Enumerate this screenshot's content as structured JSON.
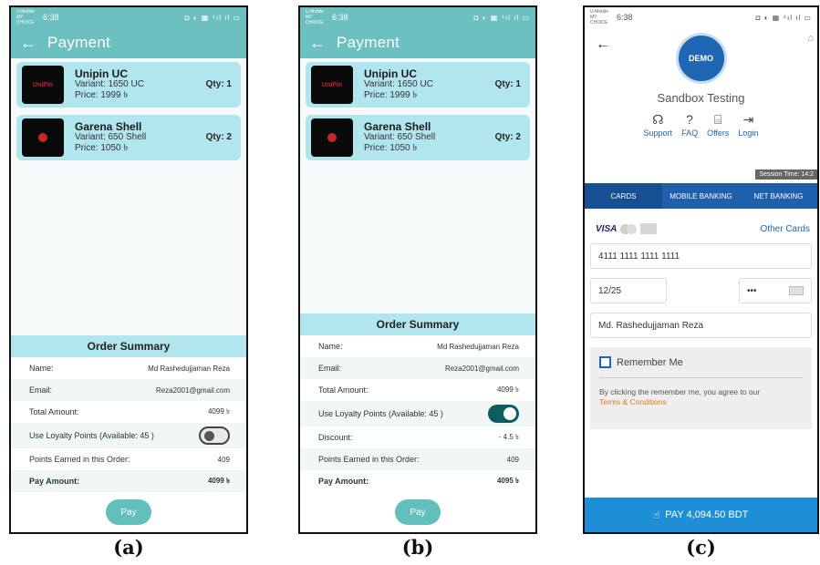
{
  "status": {
    "carrier": "U-Mobile MY CHOICE",
    "time": "6:38",
    "icons": "◘ ◐ ▦ ⁴ıl ıl ▭"
  },
  "payment_screen": {
    "back_icon": "←",
    "title": "Payment",
    "items": [
      {
        "name": "Unipin UC",
        "variant": "Variant: 1650 UC",
        "price": "Price: 1999 ৳",
        "qty": "Qty: 1",
        "thumb": "UniPin"
      },
      {
        "name": "Garena Shell",
        "variant": "Variant: 650 Shell",
        "price": "Price: 1050 ৳",
        "qty": "Qty: 2",
        "thumb": ""
      }
    ],
    "summary_title": "Order Summary",
    "labels": {
      "name": "Name:",
      "email": "Email:",
      "total": "Total Amount:",
      "loyalty": "Use Loyalty Points (Available: 45 )",
      "discount": "Discount:",
      "points": "Points Earned in this Order:",
      "pay_amount": "Pay Amount:"
    },
    "pay_label": "Pay"
  },
  "screen_a": {
    "name": "Md Rashedujjaman Reza",
    "email": "Reza2001@gmail.com",
    "total": "4099 ৳",
    "points": "409",
    "pay_amount": "4099 ৳",
    "loyalty_on": false
  },
  "screen_b": {
    "name": "Md Rashedujjaman Reza",
    "email": "Reza2001@gmail.com",
    "total": "4099 ৳",
    "discount": "- 4.5 ৳",
    "points": "409",
    "pay_amount": "4095 ৳",
    "loyalty_on": true
  },
  "screen_c": {
    "back_icon": "←",
    "logo_text": "DEMO",
    "merchant": "Sandbox Testing",
    "links": [
      {
        "icon": "headset-icon",
        "glyph": "☊",
        "label": "Support"
      },
      {
        "icon": "question-icon",
        "glyph": "?",
        "label": "FAQ"
      },
      {
        "icon": "gift-icon",
        "glyph": "⌸",
        "label": "Offers"
      },
      {
        "icon": "login-icon",
        "glyph": "⇥",
        "label": "Login"
      }
    ],
    "session": "Session Time: 14:2",
    "tabs": [
      "CARDS",
      "MOBILE BANKING",
      "NET BANKING"
    ],
    "brand_visa": "VISA",
    "other_cards": "Other Cards",
    "card_number": "4111 1111 1111 1111",
    "expiry": "12/25",
    "cvv": "•••",
    "card_name": "Md. Rashedujjaman Reza",
    "remember": "Remember Me",
    "note": "By clicking the remember me, you agree to our",
    "terms": "Terms & Conditions",
    "pay": "PAY 4,094.50 BDT"
  },
  "captions": [
    "(a)",
    "(b)",
    "(c)"
  ]
}
